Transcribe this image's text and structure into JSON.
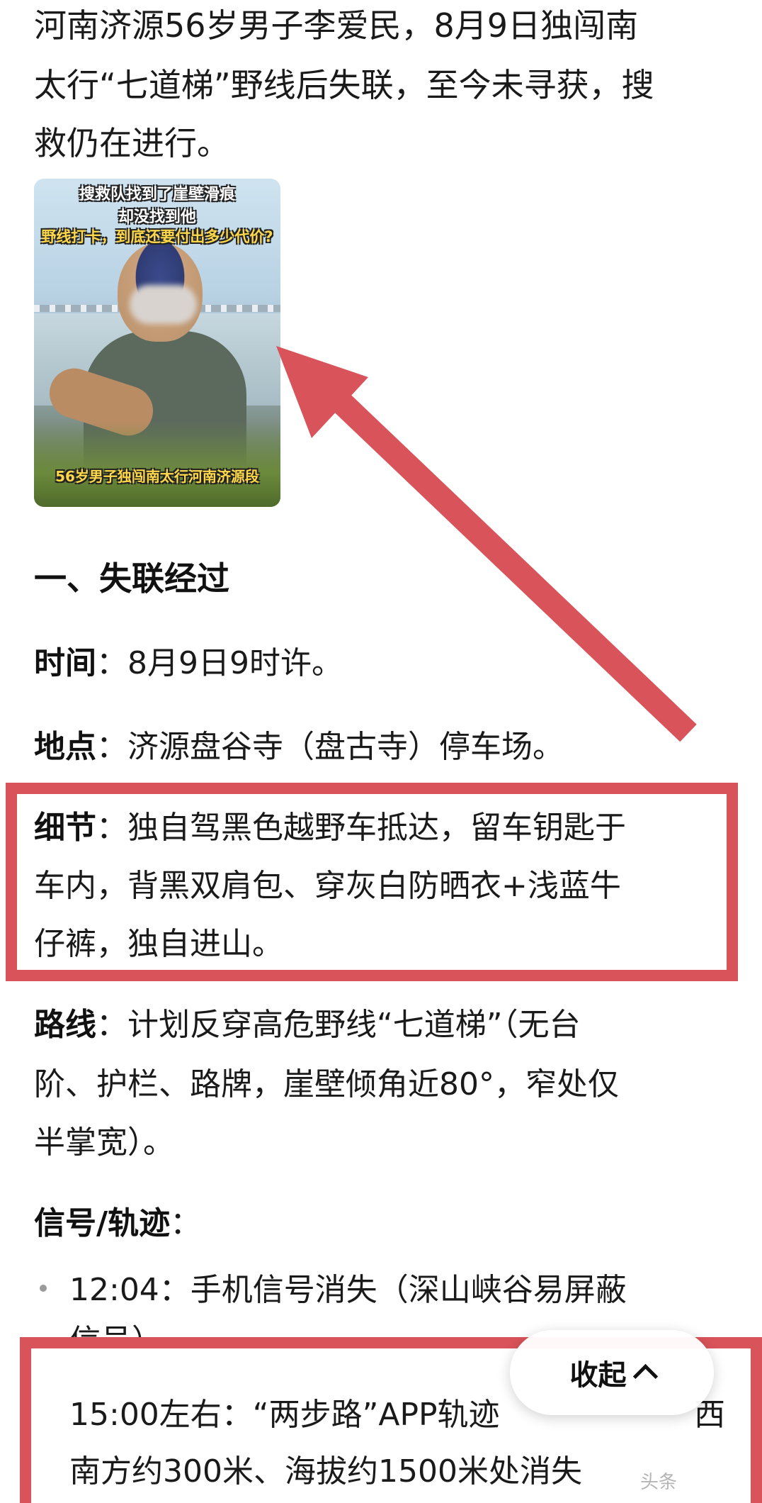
{
  "intro": {
    "line1": "河南济源56岁男子李爱民，8月9日独闯南",
    "line2": "太行“七道梯”野线后失联，至今未寻获，搜",
    "line3": "救仍在进行。"
  },
  "photo": {
    "cap1": "搜救队找到了崖壁滑痕",
    "cap2": "却没找到他",
    "cap3": "野线打卡，到底还要付出多少代价?",
    "cap4": "56岁男子独闯南太行河南济源段"
  },
  "section": {
    "heading": "一、失联经过",
    "time_label": "时间",
    "time_value": "：8月9日9时许。",
    "place_label": "地点",
    "place_value": "：济源盘谷寺（盘古寺）停车场。",
    "detail_label": "细节",
    "detail_line1": "：独自驾黑色越野车抵达，留车钥匙于",
    "detail_line2": "车内，背黑双肩包、穿灰白防晒衣+浅蓝牛",
    "detail_line3": "仔裤，独自进山。",
    "route_label": "路线",
    "route_line1": "：计划反穿高危野线“七道梯”（无台",
    "route_line2": "阶、护栏、路牌，崖壁倾角近80°，窄处仅",
    "route_line3": "半掌宽）。",
    "signal_label": "信号/轨迹",
    "signal_colon": "：",
    "bullet1_line1": "12:04：手机信号消失（深山峡谷易屏蔽",
    "bullet1_line2": "信号）。",
    "bullet2_line1": "15:00左右：“两步路”APP轨迹",
    "bullet2_line1_tail": "西",
    "bullet2_line2": "南方约300米、海拔约1500米处消失"
  },
  "collapse_button": {
    "label": "收起"
  },
  "watermark": "头条"
}
